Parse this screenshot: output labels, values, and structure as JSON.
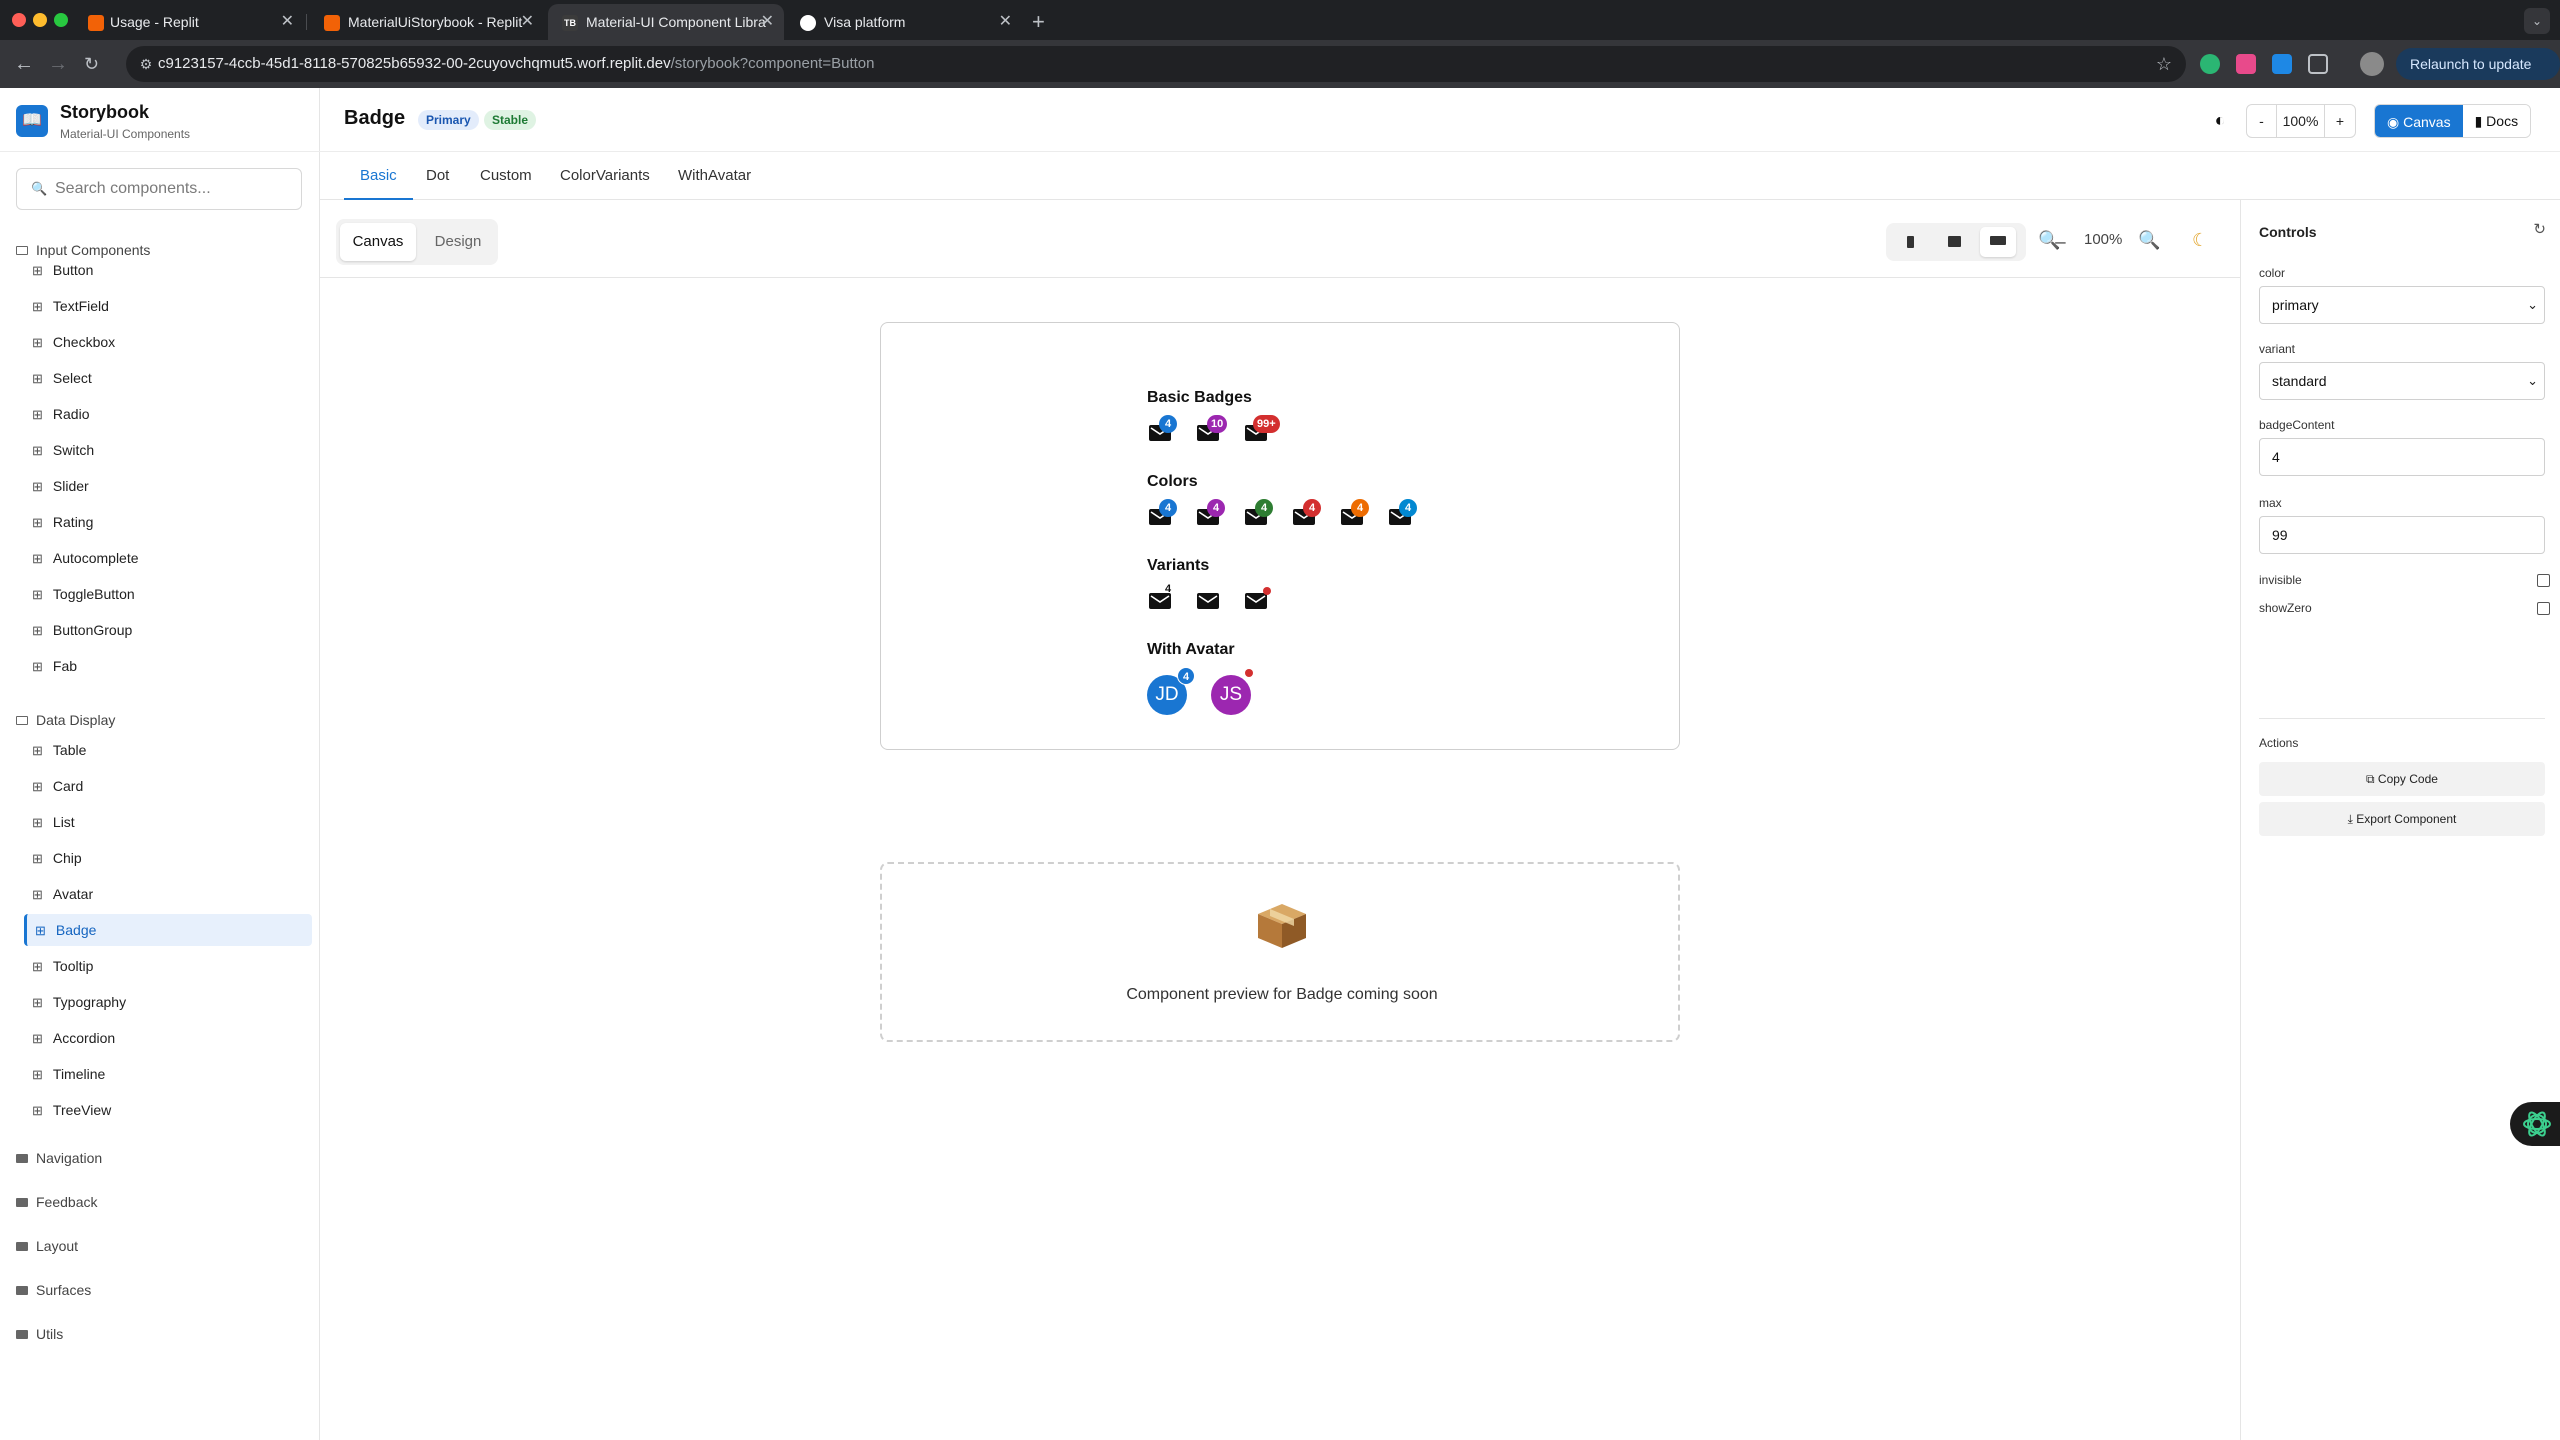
{
  "browser": {
    "tabs": [
      {
        "title": "Usage - Replit",
        "favicon": "replit-icon",
        "color": "#f26207"
      },
      {
        "title": "MaterialUiStorybook - Replit",
        "favicon": "replit-icon",
        "color": "#f26207"
      },
      {
        "title": "Material-UI Component Libra",
        "favicon": "storybook-icon",
        "color": "#3b3b3b",
        "active": true
      },
      {
        "title": "Visa platform",
        "favicon": "visa-icon",
        "color": "#ffffff"
      }
    ],
    "url_host": "c9123157-4ccb-45d1-8118-570825b65932-00-2cuyovchqmut5.worf.replit.dev",
    "url_path": "/storybook?component=Button",
    "relaunch_label": "Relaunch to update"
  },
  "brand": {
    "title": "Storybook",
    "subtitle": "Material-UI Components",
    "color": "#1976d2"
  },
  "search": {
    "placeholder": "Search components..."
  },
  "sidebar": {
    "categories": {
      "input": "Input Components",
      "data": "Data Display",
      "navigation": "Navigation",
      "feedback": "Feedback",
      "layout": "Layout",
      "surfaces": "Surfaces",
      "utils": "Utils"
    },
    "input_items": [
      "Button",
      "TextField",
      "Checkbox",
      "Select",
      "Radio",
      "Switch",
      "Slider",
      "Rating",
      "Autocomplete",
      "ToggleButton",
      "ButtonGroup",
      "Fab"
    ],
    "data_items": [
      "Table",
      "Card",
      "List",
      "Chip",
      "Avatar",
      "Badge",
      "Tooltip",
      "Typography",
      "Accordion",
      "Timeline",
      "TreeView"
    ],
    "active_item": "Badge"
  },
  "header": {
    "title": "Badge",
    "badge_primary": "Primary",
    "badge_stable": "Stable",
    "zoom_minus": "-",
    "zoom_level": "100%",
    "zoom_plus": "+",
    "canvas_label": "Canvas",
    "docs_label": "Docs"
  },
  "story_tabs": [
    "Basic",
    "Dot",
    "Custom",
    "ColorVariants",
    "WithAvatar"
  ],
  "toolbar": {
    "mode_canvas": "Canvas",
    "mode_design": "Design",
    "zoom": "100%"
  },
  "preview": {
    "basic_title": "Basic Badges",
    "basic_badges": [
      "4",
      "10",
      "99+"
    ],
    "colors_title": "Colors",
    "color_badge": "4",
    "colors": [
      "#1976d2",
      "#9c27b0",
      "#2e7d32",
      "#d32f2f",
      "#ed6c02",
      "#0288d1"
    ],
    "variants_title": "Variants",
    "variant_badge": "4",
    "avatar_title": "With Avatar",
    "avatar_1": "JD",
    "avatar_1_badge": "4",
    "avatar_2": "JS",
    "placeholder_text": "Component preview for Badge coming soon"
  },
  "controls": {
    "title": "Controls",
    "color_label": "color",
    "color_value": "primary",
    "variant_label": "variant",
    "variant_value": "standard",
    "badgeContent_label": "badgeContent",
    "badgeContent_value": "4",
    "max_label": "max",
    "max_value": "99",
    "invisible_label": "invisible",
    "showZero_label": "showZero",
    "actions_label": "Actions",
    "copy_label": "Copy Code",
    "export_label": "Export Component"
  }
}
